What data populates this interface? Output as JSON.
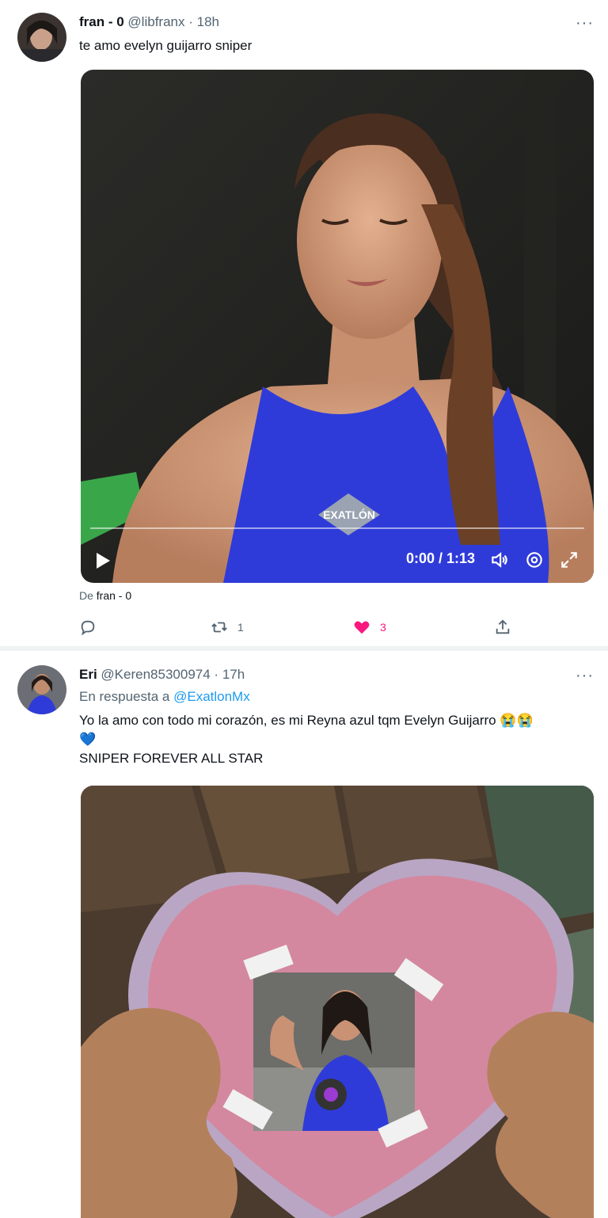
{
  "tweets": [
    {
      "display_name": "fran - 0",
      "handle": "@libfranx",
      "separator": "·",
      "time": "18h",
      "more": "···",
      "text": "te amo evelyn guijarro sniper",
      "media": {
        "type": "video",
        "time_label": "0:00 / 1:13",
        "progress": 0.0,
        "logo_text": "EXATLÓN"
      },
      "source_prefix": "De",
      "source_name": "fran - 0",
      "actions": {
        "reply_count": "",
        "retweet_count": "1",
        "like_count": "3",
        "liked": true
      }
    },
    {
      "display_name": "Eri",
      "handle": "@Keren85300974",
      "separator": "·",
      "time": "17h",
      "more": "···",
      "reply_prefix": "En respuesta a",
      "reply_mention": "@ExatlonMx",
      "text_line1": "Yo la amo con todo mi corazón, es mi Reyna azul tqm Evelyn Guijarro 😭😭",
      "text_line2": "💙",
      "text_line3": "SNIPER FOREVER ALL STAR",
      "media": {
        "type": "image"
      }
    }
  ],
  "colors": {
    "accent": "#1d9bf0",
    "like": "#f91880",
    "muted": "#536471",
    "swimsuit": "#2f3bd9"
  }
}
